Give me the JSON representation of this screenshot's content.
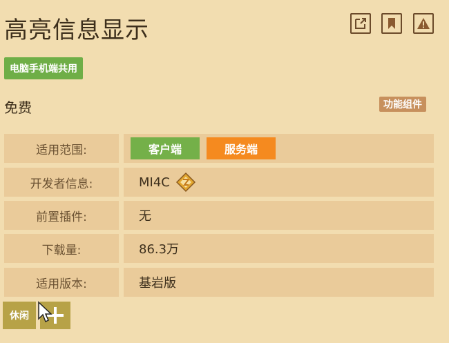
{
  "header": {
    "title": "高亮信息显示",
    "actions": [
      {
        "icon": "external-link-icon"
      },
      {
        "icon": "bookmark-icon"
      },
      {
        "icon": "warning-icon"
      }
    ]
  },
  "platform_tag": "电脑手机端共用",
  "price": "免费",
  "category_badge": "功能组件",
  "info": {
    "scope_label": "适用范围:",
    "scope_client": "客户端",
    "scope_server": "服务端",
    "developer_label": "开发者信息:",
    "developer_value": "MI4C",
    "prereq_label": "前置插件:",
    "prereq_value": "无",
    "downloads_label": "下载量:",
    "downloads_value": "86.3万",
    "version_label": "适用版本:",
    "version_value": "基岩版"
  },
  "tags": {
    "leisure": "休闲",
    "add_icon": "plus-icon"
  },
  "colors": {
    "background": "#f2ddb0",
    "row_bg": "#eacb9a",
    "green": "#74b049",
    "orange": "#f58a1f",
    "badge_brown": "#c7905d",
    "olive": "#b7a247"
  }
}
